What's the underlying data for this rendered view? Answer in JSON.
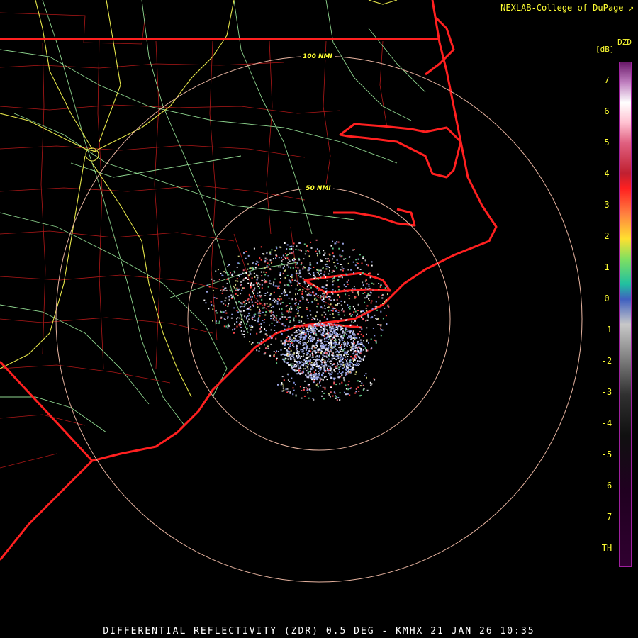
{
  "credit": "NEXLAB-College of DuPage",
  "footer": "DIFFERENTIAL REFLECTIVITY (ZDR) 0.5 DEG - KMHX 21 JAN 26 10:35",
  "legend": {
    "title": "DZD",
    "unit": "[dB]",
    "ticks": [
      "7",
      "6",
      "5",
      "4",
      "3",
      "2",
      "1",
      "0",
      "-1",
      "-2",
      "-3",
      "-4",
      "-5",
      "-6",
      "-7",
      "TH"
    ]
  },
  "range_rings": [
    "50 NMI",
    "100 NMI"
  ],
  "colors": {
    "state_border": "#ff2020",
    "county_border": "#b01818",
    "highway_primary": "#e6e64a",
    "highway_secondary": "#8fd68f",
    "range_ring": "#e8b4a0",
    "label": "#ffff33"
  }
}
